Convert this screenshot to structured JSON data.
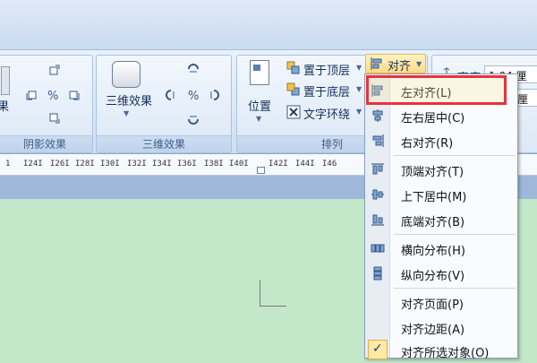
{
  "ribbon": {
    "groups": {
      "shadow_label": "阴影效果",
      "threed_label": "三维效果",
      "arrange_label": "排列"
    },
    "shadow_partial": "果",
    "threed_button": "三维效果",
    "position_button": "位置",
    "bring_front": "置于顶层",
    "send_back": "置于底层",
    "text_wrap": "文字环绕",
    "align_button": "对齐",
    "height_label": "高度",
    "height_value": "1.04 厘",
    "width_value": "厘"
  },
  "ruler": {
    "ticks": [
      "1",
      "I24I",
      "I26I",
      "I28I",
      "I30I",
      "I32I",
      "I34I",
      "I36I",
      "I38I",
      "I40I",
      "I42I",
      "I44I",
      "I46"
    ]
  },
  "menu": {
    "items": [
      {
        "label": "左对齐(L)",
        "icon": "align-left-icon"
      },
      {
        "label": "左右居中(C)",
        "icon": "align-center-icon"
      },
      {
        "label": "右对齐(R)",
        "icon": "align-right-icon"
      },
      {
        "label": "顶端对齐(T)",
        "icon": "align-top-icon"
      },
      {
        "label": "上下居中(M)",
        "icon": "align-middle-icon"
      },
      {
        "label": "底端对齐(B)",
        "icon": "align-bottom-icon"
      },
      {
        "label": "横向分布(H)",
        "icon": "distribute-horizontal-icon"
      },
      {
        "label": "纵向分布(V)",
        "icon": "distribute-vertical-icon"
      },
      {
        "label": "对齐页面(P)",
        "icon": ""
      },
      {
        "label": "对齐边距(A)",
        "icon": ""
      },
      {
        "label": "对齐所选对象(O)",
        "icon": "checkmark-icon"
      }
    ]
  },
  "colors": {
    "highlight": "#e8333a",
    "canvas": "#c3e8c9",
    "ribbon": "#dbe7f5"
  }
}
